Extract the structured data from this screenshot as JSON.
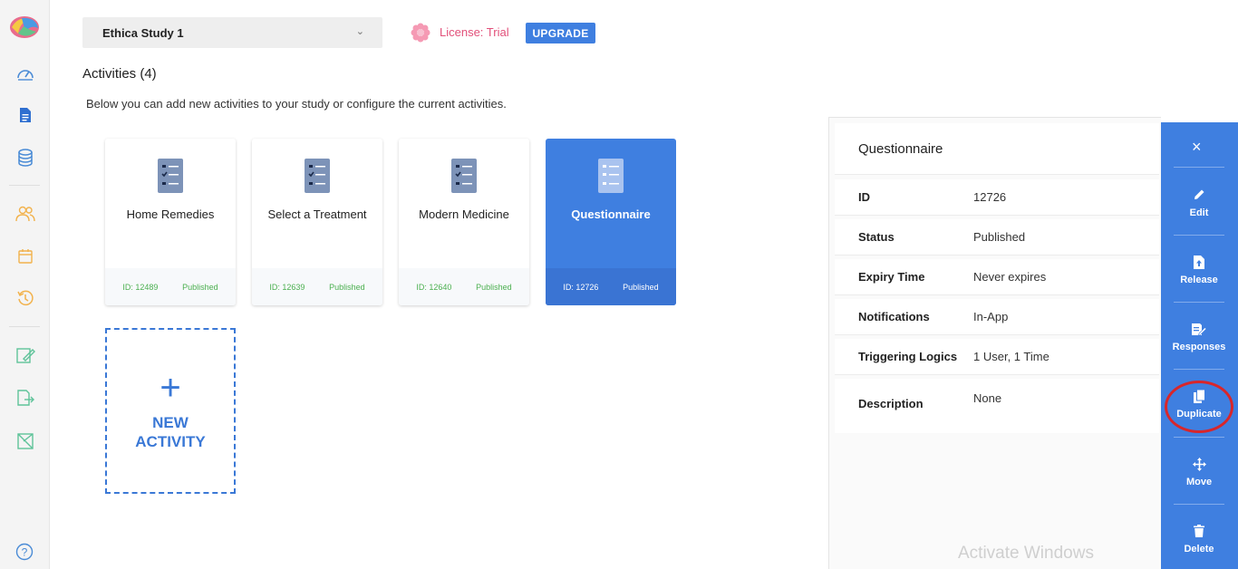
{
  "colors": {
    "accent": "#3f7fe0",
    "license": "#e2507a",
    "published": "#4cb050",
    "highlight": "#d8262b"
  },
  "sidebar": {
    "icons": [
      "logo-icon",
      "dashboard-icon",
      "activities-icon",
      "database-icon",
      "participants-icon",
      "schedule-icon",
      "history-icon",
      "survey-edit-icon",
      "export-icon",
      "analytics-icon",
      "help-icon"
    ]
  },
  "header": {
    "study_name": "Ethica Study 1",
    "license_text": "License: Trial",
    "upgrade_label": "UPGRADE"
  },
  "main": {
    "title": "Activities (4)",
    "description": "Below you can add new activities to your study or configure the current activities.",
    "activities": [
      {
        "name": "Home Remedies",
        "id": "ID: 12489",
        "status": "Published"
      },
      {
        "name": "Select a Treatment",
        "id": "ID: 12639",
        "status": "Published"
      },
      {
        "name": "Modern Medicine",
        "id": "ID: 12640",
        "status": "Published"
      },
      {
        "name": "Questionnaire",
        "id": "ID: 12726",
        "status": "Published"
      }
    ],
    "new_activity": {
      "plus": "+",
      "label": "NEW ACTIVITY"
    }
  },
  "panel": {
    "title": "Questionnaire",
    "rows": [
      {
        "key": "ID",
        "value": "12726"
      },
      {
        "key": "Status",
        "value": "Published"
      },
      {
        "key": "Expiry Time",
        "value": "Never expires"
      },
      {
        "key": "Notifications",
        "value": "In-App"
      },
      {
        "key": "Triggering Logics",
        "value": "1 User, 1 Time"
      },
      {
        "key": "Description",
        "value": "None"
      }
    ],
    "watermark": "Activate Windows"
  },
  "actions": {
    "close": "×",
    "items": [
      {
        "label": "Edit",
        "icon": "pencil-icon"
      },
      {
        "label": "Release",
        "icon": "release-icon"
      },
      {
        "label": "Responses",
        "icon": "responses-icon"
      },
      {
        "label": "Duplicate",
        "icon": "duplicate-icon"
      },
      {
        "label": "Move",
        "icon": "move-icon"
      },
      {
        "label": "Delete",
        "icon": "trash-icon"
      }
    ]
  }
}
